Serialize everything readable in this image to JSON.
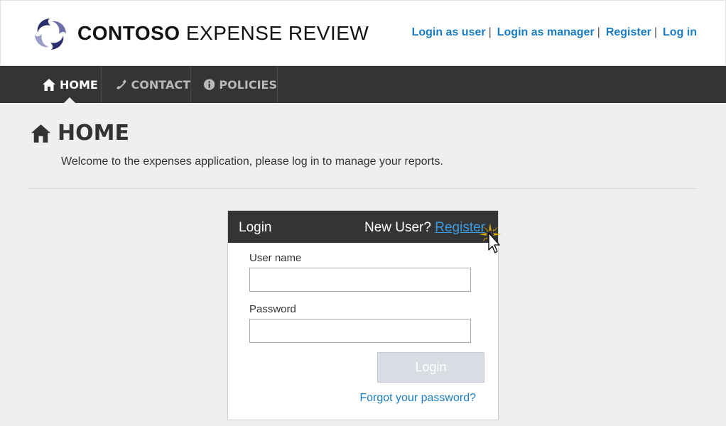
{
  "brand": {
    "name_bold": "CONTOSO",
    "name_light": "EXPENSE REVIEW",
    "logo": "contoso-swirl-logo"
  },
  "top_links": [
    {
      "label": "Login as user"
    },
    {
      "label": "Login as manager"
    },
    {
      "label": "Register"
    },
    {
      "label": "Log in"
    }
  ],
  "top_link_separator": "|",
  "nav": [
    {
      "label": "HOME",
      "icon": "home-icon",
      "active": true
    },
    {
      "label": "CONTACT",
      "icon": "phone-icon",
      "active": false
    },
    {
      "label": "POLICIES",
      "icon": "info-icon",
      "active": false
    }
  ],
  "page": {
    "title": "HOME",
    "title_icon": "home-icon",
    "welcome": "Welcome to the expenses application, please log in to manage your reports."
  },
  "login": {
    "title": "Login",
    "new_user_prompt": "New User?",
    "register_link": "Register",
    "username_label": "User name",
    "username_value": "",
    "password_label": "Password",
    "password_value": "",
    "submit_label": "Login",
    "forgot_link": "Forgot your password?"
  },
  "colors": {
    "link": "#1a7dc4",
    "nav_bg": "#333436",
    "page_bg": "#efefef"
  }
}
